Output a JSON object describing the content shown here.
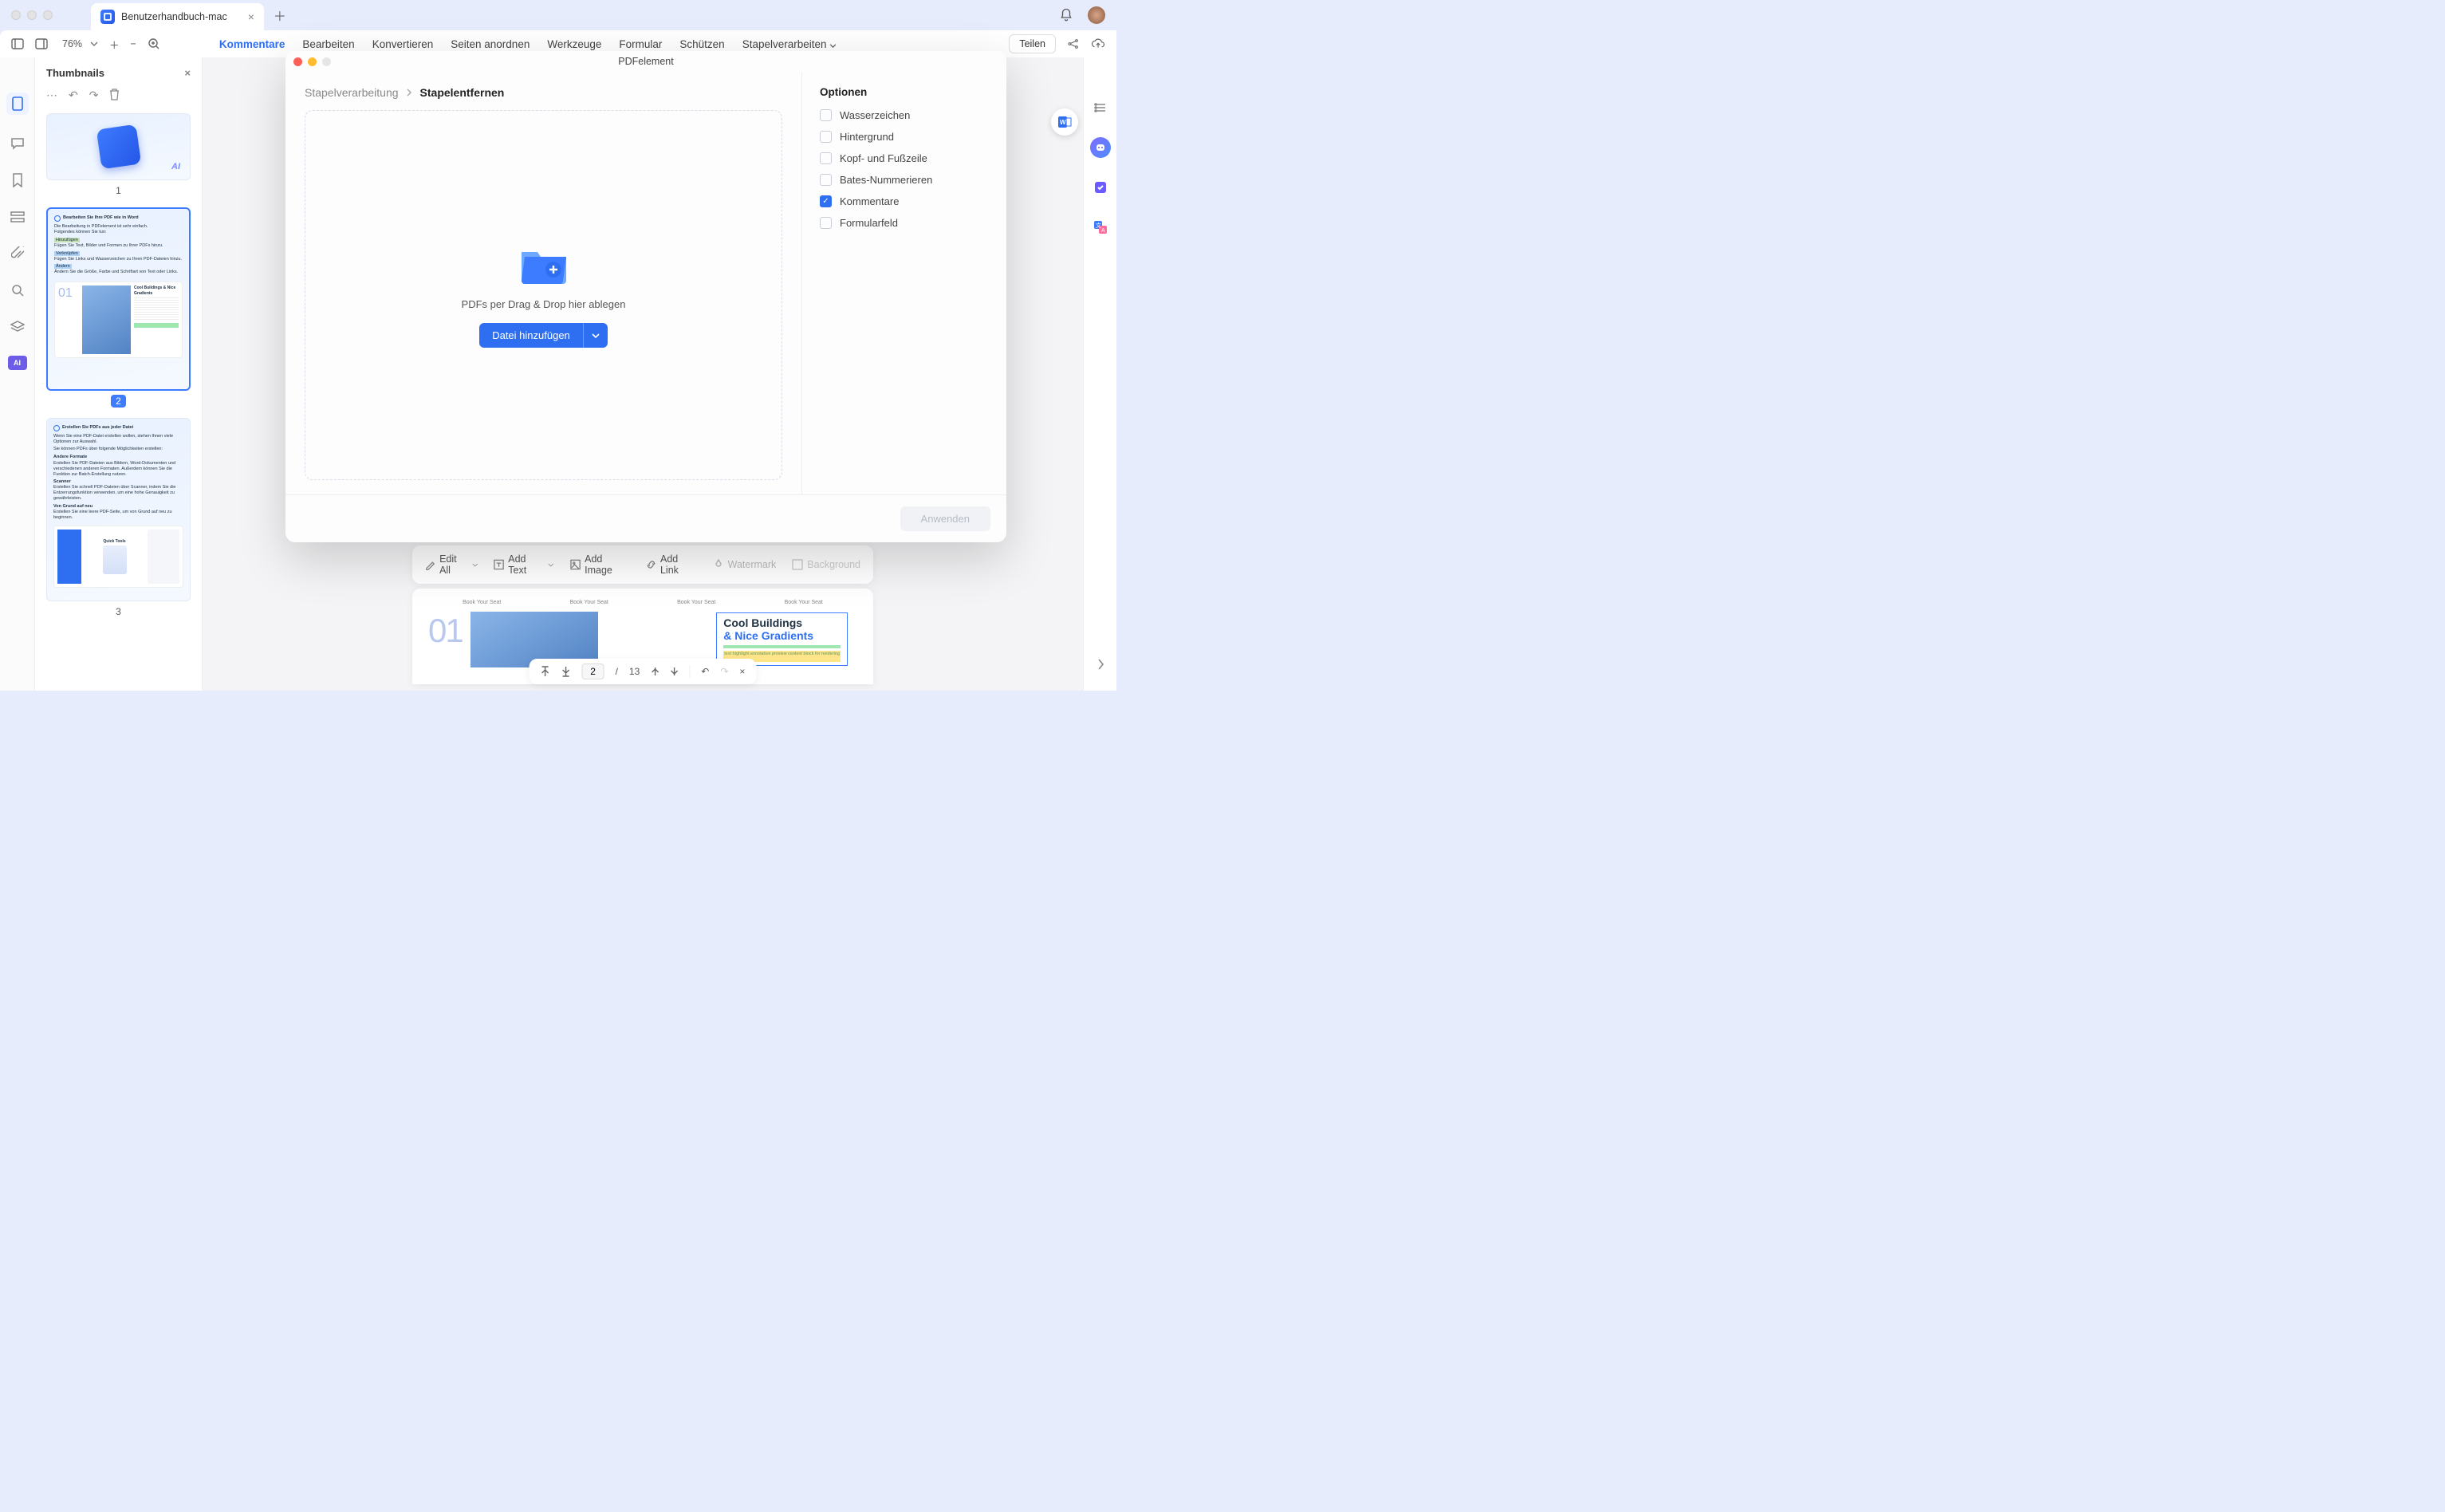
{
  "titlebar": {
    "tab_title": "Benutzerhandbuch-mac"
  },
  "toolbar": {
    "zoom": "76%",
    "menus": {
      "kommentare": "Kommentare",
      "bearbeiten": "Bearbeiten",
      "konvertieren": "Konvertieren",
      "seiten": "Seiten anordnen",
      "werkzeuge": "Werkzeuge",
      "formular": "Formular",
      "schuetzen": "Schützen",
      "stapel": "Stapelverarbeiten"
    },
    "share": "Teilen"
  },
  "rail": {
    "ai": "AI"
  },
  "thumbnails": {
    "title": "Thumbnails",
    "pages": {
      "p1": "1",
      "p2": "2",
      "p3": "3"
    },
    "pg2": {
      "title": "Bearbeiten Sie Ihre PDF wie in Word",
      "l1": "Die Bearbeitung in PDFelement ist sehr einfach.",
      "l2": "Folgendes können Sie tun:",
      "h1": "Hinzufügen",
      "h1d": "Fügen Sie Text, Bilder und Formen zu Ihrer PDFs hinzu.",
      "h2": "Verknüpfen",
      "h2d": "Fügen Sie Links und Wasserzeichen zu Ihren PDF-Dateien hinzu.",
      "h3": "Ändern",
      "h3d": "Ändern Sie die Größe, Farbe und Schriftart von Text oder Links.",
      "bigtitle": "Cool Buildings & Nice Gradients"
    },
    "pg3": {
      "title": "Erstellen Sie PDFs aus jeder Datei",
      "l1": "Wenn Sie eine PDF-Datei erstellen wollen, stehen Ihnen viele Optionen zur Auswahl.",
      "l2": "Sie können PDFs über folgende Möglichkeiten erstellen:",
      "h1": "Andere Formate",
      "h1d": "Erstellen Sie PDF-Dateien aus Bildern, Word-Dokumenten und verschiedenen anderen Formaten. Außerdem können Sie die Funktion zur Batch-Erstellung nutzen.",
      "h2": "Scanner",
      "h2d": "Erstellen Sie schnell PDF-Dateien über Scanner, indem Sie die Entzerrungsfunktion verwenden, um eine hohe Genauigkeit zu gewährleisten.",
      "h3": "Von Grund auf neu",
      "h3d": "Erstellen Sie eine leere PDF-Seite, um von Grund auf neu zu beginnen.",
      "quick": "Quick Tools"
    }
  },
  "editbar": {
    "editall": "Edit All",
    "addtext": "Add Text",
    "addimage": "Add Image",
    "addlink": "Add Link",
    "watermark": "Watermark",
    "background": "Background"
  },
  "preview": {
    "book": "Book Your Seat",
    "cool": "Cool Buildings",
    "grad": "& Nice Gradients"
  },
  "pager": {
    "current": "2",
    "total": "13",
    "sep": "/"
  },
  "modal": {
    "title": "PDFelement",
    "breadcrumb": {
      "parent": "Stapelverarbeitung",
      "current": "Stapelentfernen"
    },
    "drop_text": "PDFs per Drag & Drop hier ablegen",
    "add_file": "Datei hinzufügen",
    "options_title": "Optionen",
    "opts": {
      "wasser": "Wasserzeichen",
      "hinter": "Hintergrund",
      "kopf": "Kopf- und Fußzeile",
      "bates": "Bates-Nummerieren",
      "komm": "Kommentare",
      "form": "Formularfeld"
    },
    "apply": "Anwenden"
  }
}
